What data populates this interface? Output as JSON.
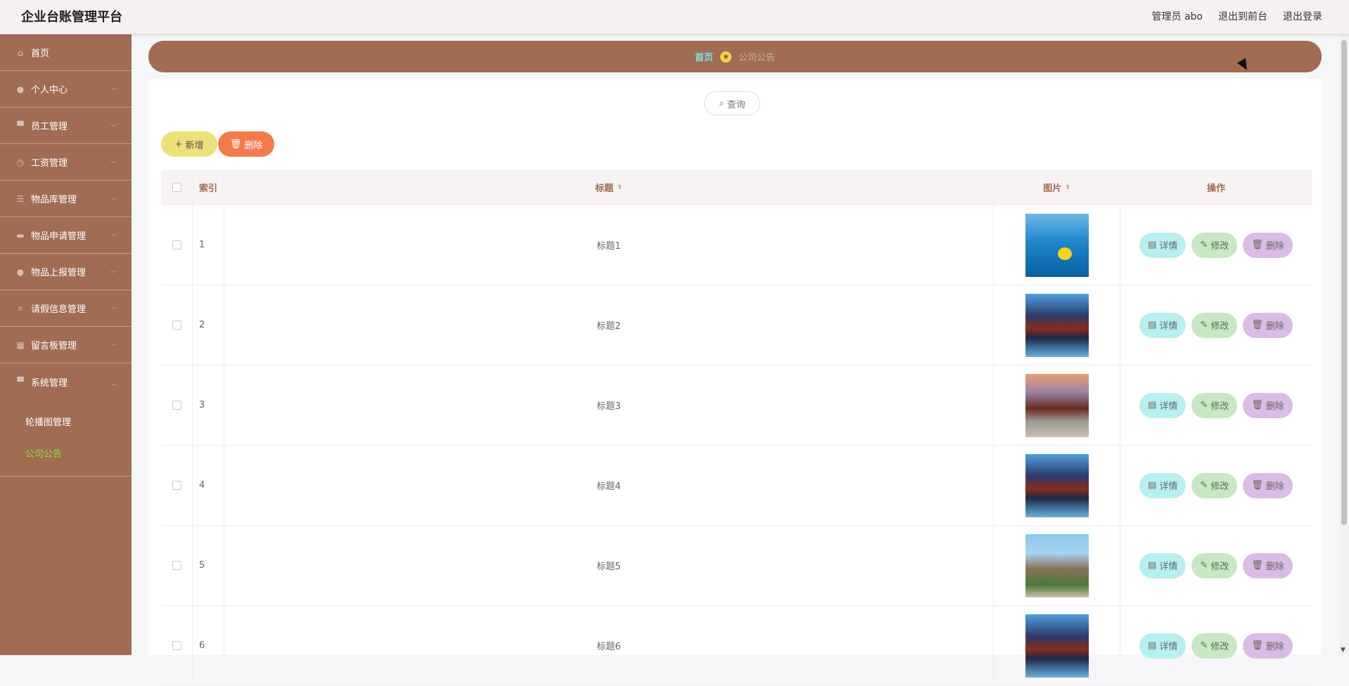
{
  "header": {
    "title": "企业台账管理平台",
    "links": {
      "admin": "管理员 abo",
      "front": "退出到前台",
      "logout": "退出登录"
    }
  },
  "sidebar": {
    "items": [
      {
        "label": "首页",
        "icon": "home-icon"
      },
      {
        "label": "个人中心",
        "icon": "user-icon"
      },
      {
        "label": "员工管理",
        "icon": "monitor-icon"
      },
      {
        "label": "工资管理",
        "icon": "clock-icon"
      },
      {
        "label": "物品库管理",
        "icon": "list-icon"
      },
      {
        "label": "物品申请管理",
        "icon": "ticket-icon"
      },
      {
        "label": "物品上报管理",
        "icon": "user-icon"
      },
      {
        "label": "请假信息管理",
        "icon": "crop-icon"
      },
      {
        "label": "留言板管理",
        "icon": "grid-icon"
      },
      {
        "label": "系统管理",
        "icon": "monitor-icon"
      }
    ],
    "sub_items": [
      {
        "label": "轮播图管理"
      },
      {
        "label": "公司公告"
      }
    ]
  },
  "breadcrumb": {
    "home": "首页",
    "current": "公司公告"
  },
  "toolbar": {
    "search": "查询",
    "add": "新增",
    "delete": "删除"
  },
  "table": {
    "headers": {
      "index": "索引",
      "title": "标题",
      "image": "图片",
      "ops": "操作"
    },
    "rows": [
      {
        "index": "1",
        "title": "标题1"
      },
      {
        "index": "2",
        "title": "标题2"
      },
      {
        "index": "3",
        "title": "标题3"
      },
      {
        "index": "4",
        "title": "标题4"
      },
      {
        "index": "5",
        "title": "标题5"
      },
      {
        "index": "6",
        "title": "标题6"
      }
    ],
    "op_labels": {
      "detail": "详情",
      "edit": "修改",
      "delete": "删除"
    }
  },
  "colors": {
    "sidebar": "#a06c52",
    "active_sub": "#8ce04a",
    "add_button": "#ece27a",
    "delete_button": "#f47a4b"
  }
}
